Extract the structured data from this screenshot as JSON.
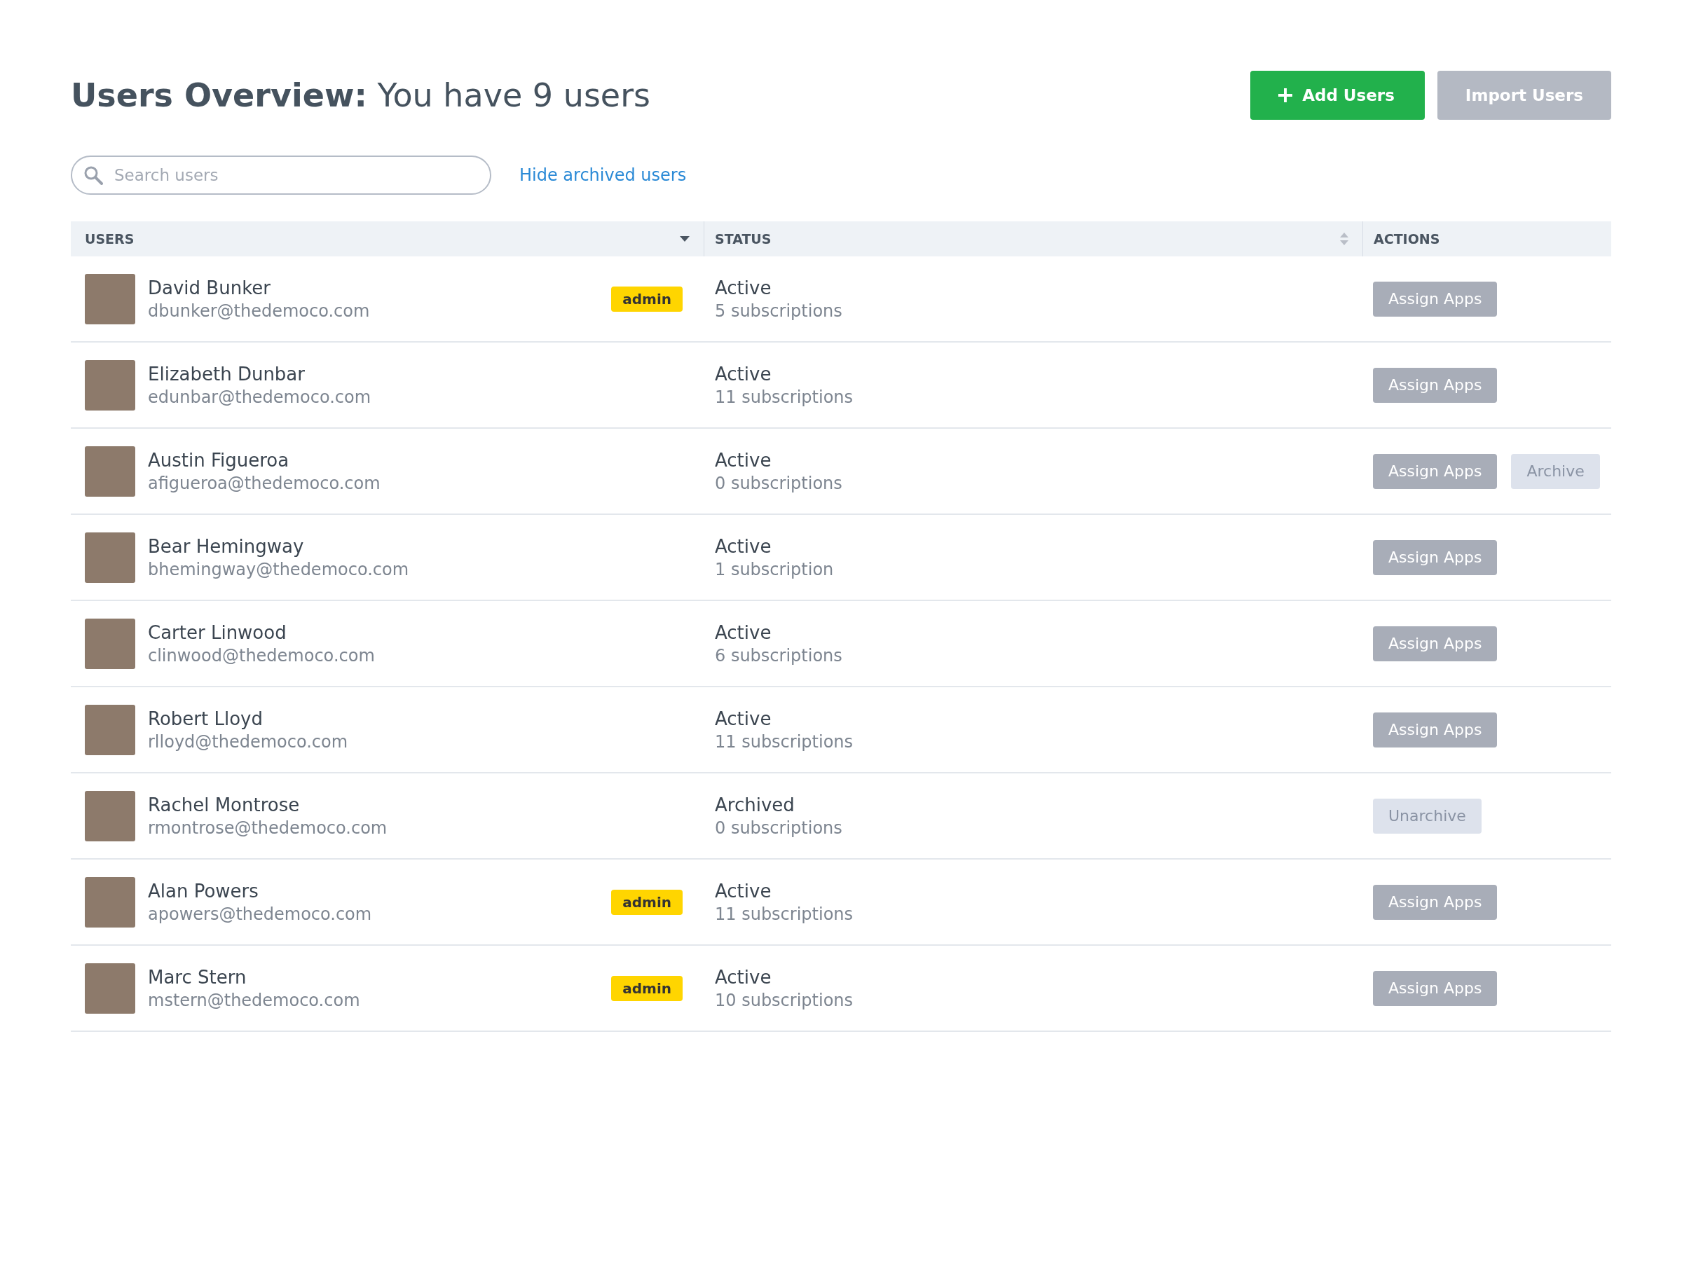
{
  "header": {
    "title_bold": "Users Overview:",
    "title_rest": "You have 9 users",
    "buttons": [
      {
        "kind": "primary",
        "label": "Add Users"
      },
      {
        "kind": "secondary",
        "label": "Import Users"
      }
    ]
  },
  "search": {
    "placeholder": "Search users"
  },
  "filter_link": "Hide archived users",
  "table": {
    "columns": [
      {
        "label": "USERS"
      },
      {
        "label": "STATUS"
      },
      {
        "label": "ACTIONS"
      }
    ],
    "rows": [
      {
        "name": "David Bunker",
        "email": "dbunker@thedemoco.com",
        "badge": "admin",
        "status": "Active",
        "subscriptions": "5 subscriptions",
        "actions": [
          {
            "kind": "primary",
            "label": "Assign Apps"
          }
        ]
      },
      {
        "name": "Elizabeth Dunbar",
        "email": "edunbar@thedemoco.com",
        "status": "Active",
        "subscriptions": "11 subscriptions",
        "actions": [
          {
            "kind": "primary",
            "label": "Assign Apps"
          }
        ]
      },
      {
        "name": "Austin Figueroa",
        "email": "afigueroa@thedemoco.com",
        "status": "Active",
        "subscriptions": "0 subscriptions",
        "actions": [
          {
            "kind": "primary",
            "label": "Assign Apps"
          },
          {
            "kind": "light",
            "label": "Archive"
          }
        ]
      },
      {
        "name": "Bear Hemingway",
        "email": "bhemingway@thedemoco.com",
        "status": "Active",
        "subscriptions": "1 subscription",
        "actions": [
          {
            "kind": "primary",
            "label": "Assign Apps"
          }
        ]
      },
      {
        "name": "Carter Linwood",
        "email": "clinwood@thedemoco.com",
        "status": "Active",
        "subscriptions": "6 subscriptions",
        "actions": [
          {
            "kind": "primary",
            "label": "Assign Apps"
          }
        ]
      },
      {
        "name": "Robert Lloyd",
        "email": "rlloyd@thedemoco.com",
        "status": "Active",
        "subscriptions": "11 subscriptions",
        "actions": [
          {
            "kind": "primary",
            "label": "Assign Apps"
          }
        ]
      },
      {
        "name": "Rachel Montrose",
        "email": "rmontrose@thedemoco.com",
        "status": "Archived",
        "subscriptions": "0 subscriptions",
        "actions": [
          {
            "kind": "light",
            "label": "Unarchive"
          }
        ]
      },
      {
        "name": "Alan Powers",
        "email": "apowers@thedemoco.com",
        "badge": "admin",
        "status": "Active",
        "subscriptions": "11 subscriptions",
        "actions": [
          {
            "kind": "primary",
            "label": "Assign Apps"
          }
        ]
      },
      {
        "name": "Marc Stern",
        "email": "mstern@thedemoco.com",
        "badge": "admin",
        "status": "Active",
        "subscriptions": "10 subscriptions",
        "actions": [
          {
            "kind": "primary",
            "label": "Assign Apps"
          }
        ]
      }
    ]
  }
}
